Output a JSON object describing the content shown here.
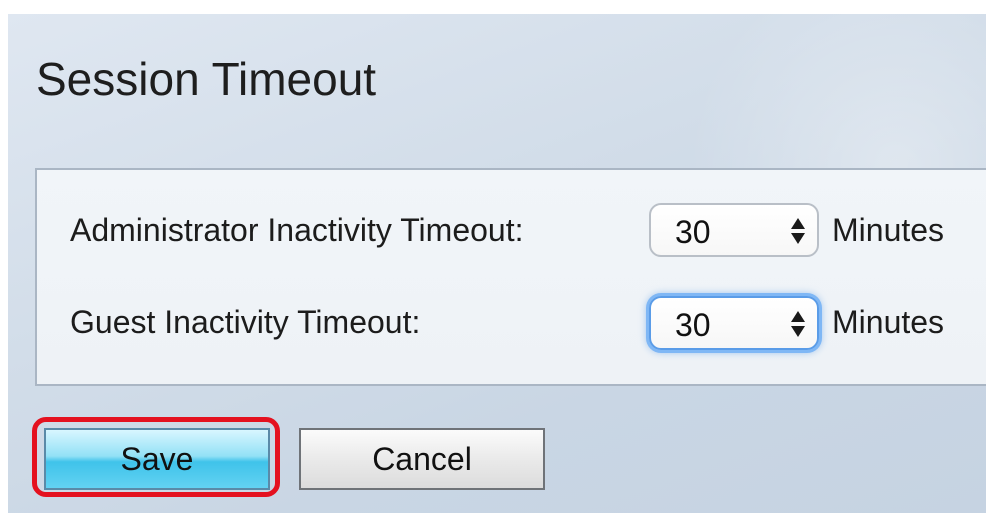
{
  "page": {
    "title": "Session Timeout"
  },
  "settings": {
    "admin_timeout": {
      "label": "Administrator Inactivity Timeout:",
      "value": "30",
      "unit": "Minutes"
    },
    "guest_timeout": {
      "label": "Guest Inactivity Timeout:",
      "value": "30",
      "unit": "Minutes",
      "focused": true
    }
  },
  "actions": {
    "save_label": "Save",
    "cancel_label": "Cancel",
    "highlight_color": "#e4111f"
  },
  "icons": {
    "spinner": "up-down-arrows-icon"
  }
}
